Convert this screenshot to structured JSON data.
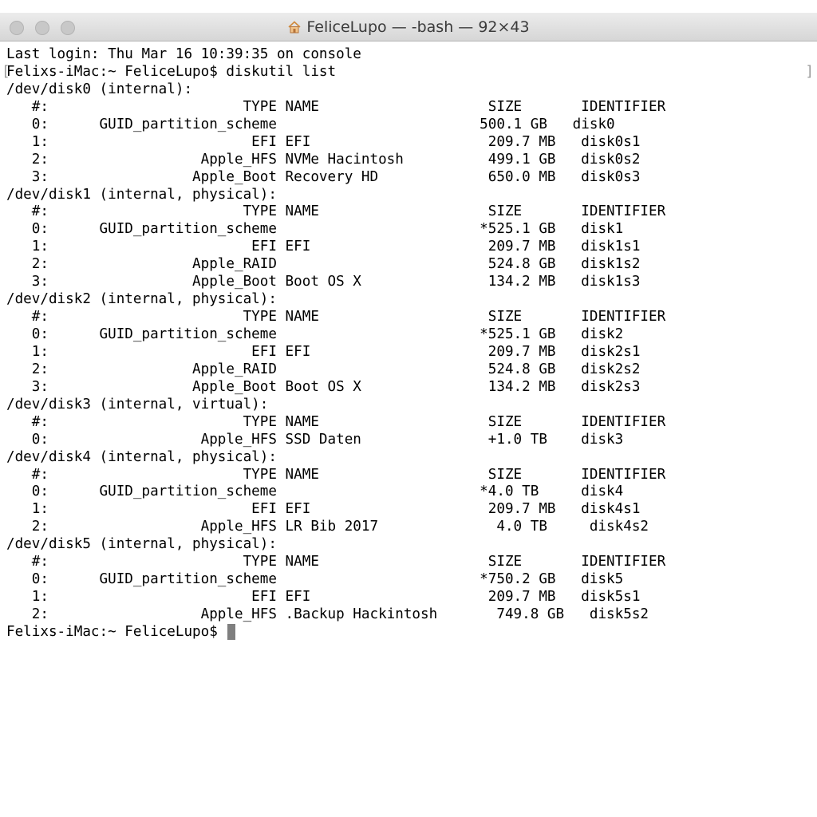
{
  "window": {
    "title": "FeliceLupo — -bash — 92×43",
    "title_icon": "home-icon"
  },
  "terminal": {
    "lines": [
      "Last login: Thu Mar 16 10:39:35 on console",
      "Felixs-iMac:~ FeliceLupo$ diskutil list",
      "/dev/disk0 (internal):",
      "   #:                       TYPE NAME                    SIZE       IDENTIFIER",
      "   0:      GUID_partition_scheme                        500.1 GB   disk0",
      "   1:                        EFI EFI                     209.7 MB   disk0s1",
      "   2:                  Apple_HFS NVMe Hacintosh          499.1 GB   disk0s2",
      "   3:                 Apple_Boot Recovery HD             650.0 MB   disk0s3",
      "/dev/disk1 (internal, physical):",
      "   #:                       TYPE NAME                    SIZE       IDENTIFIER",
      "   0:      GUID_partition_scheme                        *525.1 GB   disk1",
      "   1:                        EFI EFI                     209.7 MB   disk1s1",
      "   2:                 Apple_RAID                         524.8 GB   disk1s2",
      "   3:                 Apple_Boot Boot OS X               134.2 MB   disk1s3",
      "/dev/disk2 (internal, physical):",
      "   #:                       TYPE NAME                    SIZE       IDENTIFIER",
      "   0:      GUID_partition_scheme                        *525.1 GB   disk2",
      "   1:                        EFI EFI                     209.7 MB   disk2s1",
      "   2:                 Apple_RAID                         524.8 GB   disk2s2",
      "   3:                 Apple_Boot Boot OS X               134.2 MB   disk2s3",
      "/dev/disk3 (internal, virtual):",
      "   #:                       TYPE NAME                    SIZE       IDENTIFIER",
      "   0:                  Apple_HFS SSD Daten               +1.0 TB    disk3",
      "/dev/disk4 (internal, physical):",
      "   #:                       TYPE NAME                    SIZE       IDENTIFIER",
      "   0:      GUID_partition_scheme                        *4.0 TB     disk4",
      "   1:                        EFI EFI                     209.7 MB   disk4s1",
      "   2:                  Apple_HFS LR Bib 2017              4.0 TB     disk4s2",
      "/dev/disk5 (internal, physical):",
      "   #:                       TYPE NAME                    SIZE       IDENTIFIER",
      "   0:      GUID_partition_scheme                        *750.2 GB   disk5",
      "   1:                        EFI EFI                     209.7 MB   disk5s1",
      "   2:                  Apple_HFS .Backup Hackintosh       749.8 GB   disk5s2"
    ],
    "prompt": "Felixs-iMac:~ FeliceLupo$ ",
    "bracket_left": "[",
    "bracket_right": "]"
  }
}
